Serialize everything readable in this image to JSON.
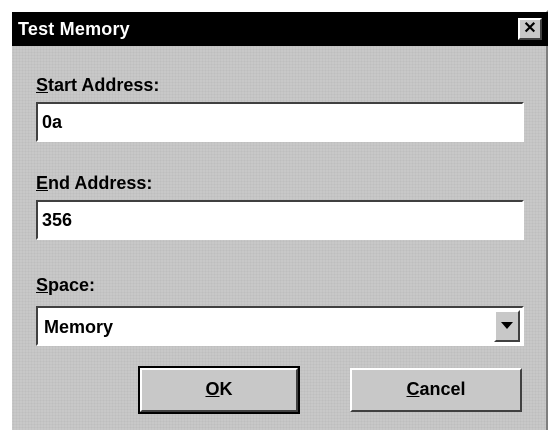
{
  "window": {
    "title": "Test Memory",
    "close_symbol": "✕"
  },
  "start_address": {
    "label_accel": "S",
    "label_rest": "tart Address:",
    "value": "0a"
  },
  "end_address": {
    "label_accel": "E",
    "label_rest": "nd Address:",
    "value": "356"
  },
  "space": {
    "label_accel": "S",
    "label_rest": "pace:",
    "selected": "Memory"
  },
  "buttons": {
    "ok_accel": "O",
    "ok_rest": "K",
    "cancel_accel": "C",
    "cancel_rest": "ancel"
  },
  "colors": {
    "titlebar": "#000000",
    "dialog_face": "#c8c8c8",
    "field_bg": "#ffffff"
  }
}
